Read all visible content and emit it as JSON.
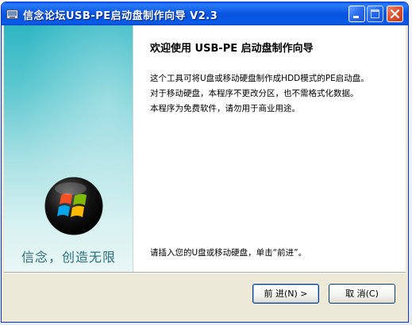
{
  "window": {
    "title": "信念论坛USB-PE启动盘制作向导 V2.3",
    "controls": {
      "minimize_icon": "minimize-icon",
      "maximize_icon": "maximize-icon",
      "close_icon": "close-icon"
    }
  },
  "banner": {
    "logo_icon": "windows-logo-icon",
    "slogan": "信念，创造无限"
  },
  "content": {
    "title": "欢迎使用 USB-PE 启动盘制作向导",
    "description_lines": [
      "这个工具可将U盘或移动硬盘制作成HDD模式的PE启动盘。",
      "对于移动硬盘，本程序不更改分区，也不需格式化数据。",
      "本程序为免费软件，请勿用于商业用途。"
    ],
    "prompt": "请插入您的U盘或移动硬盘，单击“前进”。"
  },
  "buttons": {
    "next": "前 进(N) >",
    "cancel": "取 消(C)"
  },
  "colors": {
    "titlebar": "#0a5bea",
    "banner_top": "#2fb6c3",
    "slogan": "#2d6e7a"
  }
}
